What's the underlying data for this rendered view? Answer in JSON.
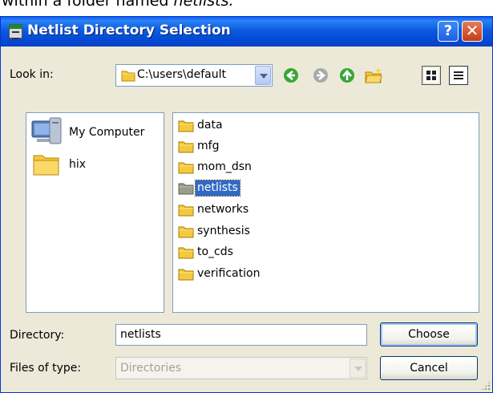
{
  "caption": {
    "prefix": "within a folder named ",
    "italic": "netlists."
  },
  "window": {
    "title": "Netlist Directory Selection",
    "help_glyph": "?",
    "close_glyph": "✕",
    "titlebar_color": "#0a5ee8"
  },
  "toolbar": {
    "look_in_label": "Look in:",
    "look_in_value": "C:\\users\\default",
    "icons": [
      "back-icon",
      "forward-icon",
      "up-folder-icon",
      "new-folder-icon",
      "list-view-icon",
      "details-view-icon"
    ]
  },
  "places": [
    {
      "label": "My Computer",
      "icon": "computer-icon"
    },
    {
      "label": "hix",
      "icon": "folder-icon"
    }
  ],
  "files": [
    {
      "name": "data",
      "selected": false
    },
    {
      "name": "mfg",
      "selected": false
    },
    {
      "name": "mom_dsn",
      "selected": false
    },
    {
      "name": "netlists",
      "selected": true
    },
    {
      "name": "networks",
      "selected": false
    },
    {
      "name": "synthesis",
      "selected": false
    },
    {
      "name": "to_cds",
      "selected": false
    },
    {
      "name": "verification",
      "selected": false
    }
  ],
  "form": {
    "directory_label": "Directory:",
    "directory_value": "netlists",
    "type_label": "Files of type:",
    "type_value": "Directories"
  },
  "buttons": {
    "choose": "Choose",
    "cancel": "Cancel"
  },
  "colors": {
    "selection": "#316ac5",
    "folder": "#f5c93b",
    "dialog_bg": "#ece9d8"
  }
}
